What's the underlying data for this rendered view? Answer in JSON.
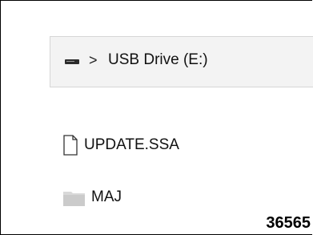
{
  "address_bar": {
    "drive_icon": "usb-drive-icon",
    "separator": ">",
    "location": "USB Drive (E:)"
  },
  "files": [
    {
      "name": "UPDATE.SSA",
      "icon": "file-icon"
    },
    {
      "name": "MAJ",
      "icon": "folder-icon"
    }
  ],
  "reference_number": "36565",
  "colors": {
    "address_bar_bg": "#f3f3f3",
    "folder": "#d9d9d9"
  }
}
